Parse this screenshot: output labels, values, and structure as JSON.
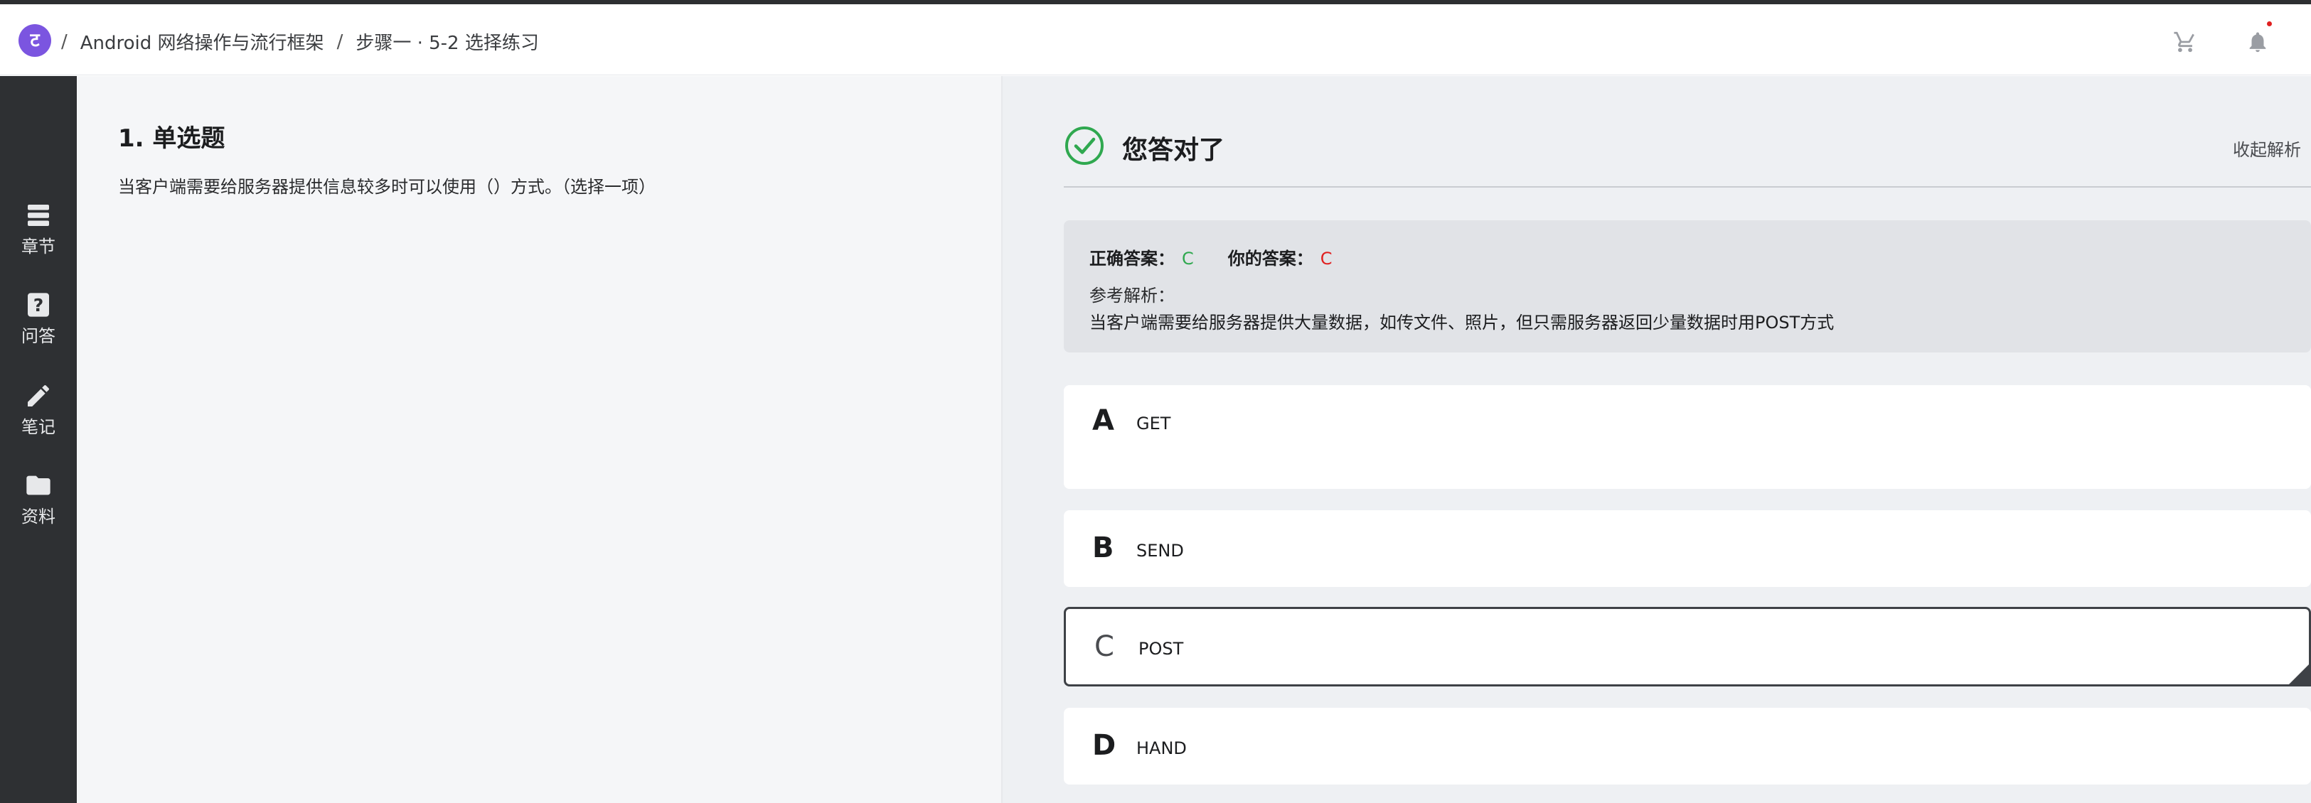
{
  "header": {
    "logo_glyph": "ट",
    "breadcrumb": {
      "sep": "/",
      "course": "Android 网络操作与流行框架",
      "lesson": "步骤一 · 5-2 选择练习"
    },
    "icons": [
      "cart-icon",
      "bell-icon"
    ]
  },
  "sidebar": {
    "items": [
      {
        "label": "章节",
        "icon": "chapters-icon"
      },
      {
        "label": "问答",
        "icon": "question-icon"
      },
      {
        "label": "笔记",
        "icon": "pencil-icon"
      },
      {
        "label": "资料",
        "icon": "folder-icon"
      }
    ]
  },
  "question": {
    "title": "1. 单选题",
    "text": "当客户端需要给服务器提供信息较多时可以使用（）方式。（选择一项）"
  },
  "result": {
    "title": "您答对了",
    "collapse_label": "收起解析",
    "correct_label": "正确答案：",
    "correct_value": "C",
    "yours_label": "你的答案：",
    "yours_value": "C",
    "ref_label": "参考解析：",
    "ref_text": "当客户端需要给服务器提供大量数据，如传文件、照片，但只需服务器返回少量数据时用POST方式"
  },
  "options": [
    {
      "letter": "A",
      "text": "GET"
    },
    {
      "letter": "B",
      "text": "SEND"
    },
    {
      "letter": "C",
      "text": "POST"
    },
    {
      "letter": "D",
      "text": "HAND"
    }
  ],
  "colors": {
    "correct": "#2fa84f",
    "wrong": "#e02020",
    "sidebar": "#2e3033",
    "logo": "#7b55e0"
  }
}
